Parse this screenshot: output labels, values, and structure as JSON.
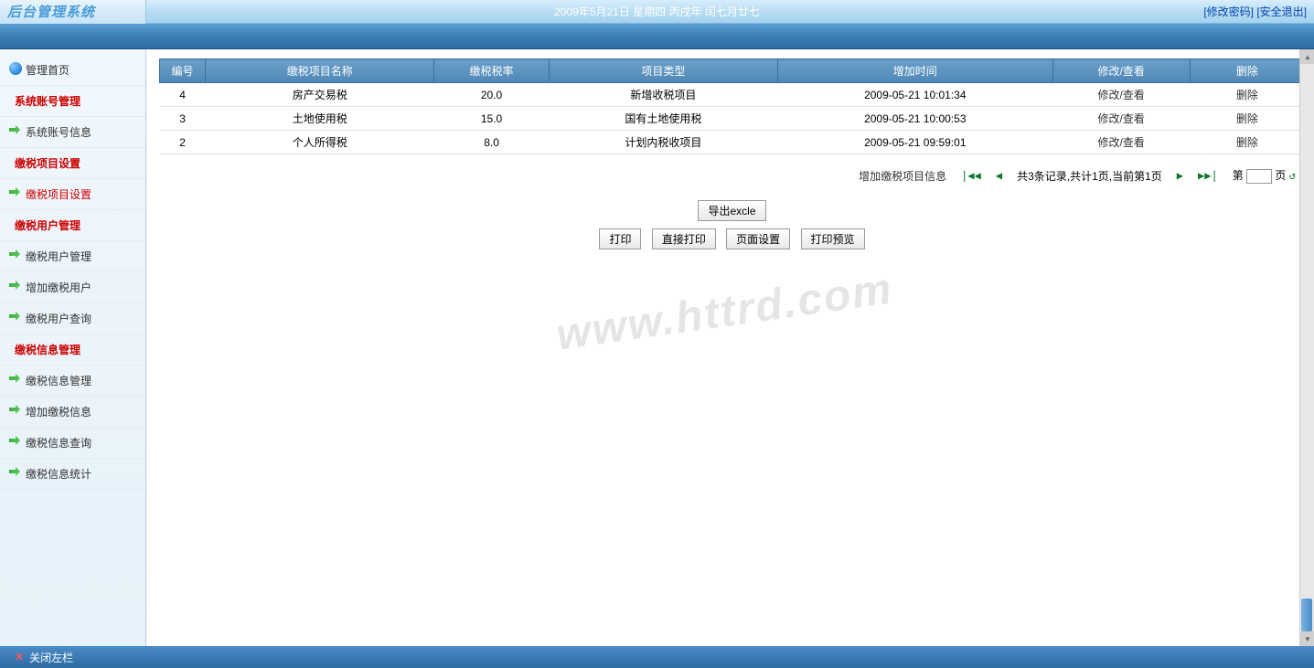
{
  "header": {
    "logo": "后台管理系统",
    "date": "2009年5月21日 星期四 丙戌年 闰七月廿七",
    "link_password": "[修改密码]",
    "link_logout": "[安全退出]"
  },
  "sidebar": {
    "home": "管理首页",
    "groups": [
      {
        "header": "系统账号管理",
        "items": [
          {
            "label": "系统账号信息",
            "active": false
          }
        ]
      },
      {
        "header": "缴税项目设置",
        "items": [
          {
            "label": "缴税项目设置",
            "active": true
          }
        ]
      },
      {
        "header": "缴税用户管理",
        "items": [
          {
            "label": "缴税用户管理",
            "active": false
          },
          {
            "label": "增加缴税用户",
            "active": false
          },
          {
            "label": "缴税用户查询",
            "active": false
          }
        ]
      },
      {
        "header": "缴税信息管理",
        "items": [
          {
            "label": "缴税信息管理",
            "active": false
          },
          {
            "label": "增加缴税信息",
            "active": false
          },
          {
            "label": "缴税信息查询",
            "active": false
          },
          {
            "label": "缴税信息统计",
            "active": false
          }
        ]
      }
    ]
  },
  "table": {
    "headers": [
      "编号",
      "缴税项目名称",
      "缴税税率",
      "项目类型",
      "增加时间",
      "修改/查看",
      "删除"
    ],
    "rows": [
      {
        "id": "4",
        "name": "房产交易税",
        "rate": "20.0",
        "type": "新增收税项目",
        "time": "2009-05-21 10:01:34",
        "edit": "修改/查看",
        "del": "删除"
      },
      {
        "id": "3",
        "name": "土地使用税",
        "rate": "15.0",
        "type": "国有土地使用税",
        "time": "2009-05-21 10:00:53",
        "edit": "修改/查看",
        "del": "删除"
      },
      {
        "id": "2",
        "name": "个人所得税",
        "rate": "8.0",
        "type": "计划内税收项目",
        "time": "2009-05-21 09:59:01",
        "edit": "修改/查看",
        "del": "删除"
      }
    ]
  },
  "pager": {
    "add_link": "增加缴税项目信息",
    "summary": "共3条记录,共计1页,当前第1页",
    "jump_prefix": "第",
    "jump_suffix": "页",
    "first": "|◀◀",
    "prev": "◀",
    "next": "▶",
    "last": "▶▶|",
    "go": "↺"
  },
  "actions": {
    "export": "导出excle",
    "print": "打印",
    "direct_print": "直接打印",
    "page_setup": "页面设置",
    "print_preview": "打印预览"
  },
  "watermark": "www.httrd.com",
  "footer": {
    "close_left": "关闭左栏"
  }
}
